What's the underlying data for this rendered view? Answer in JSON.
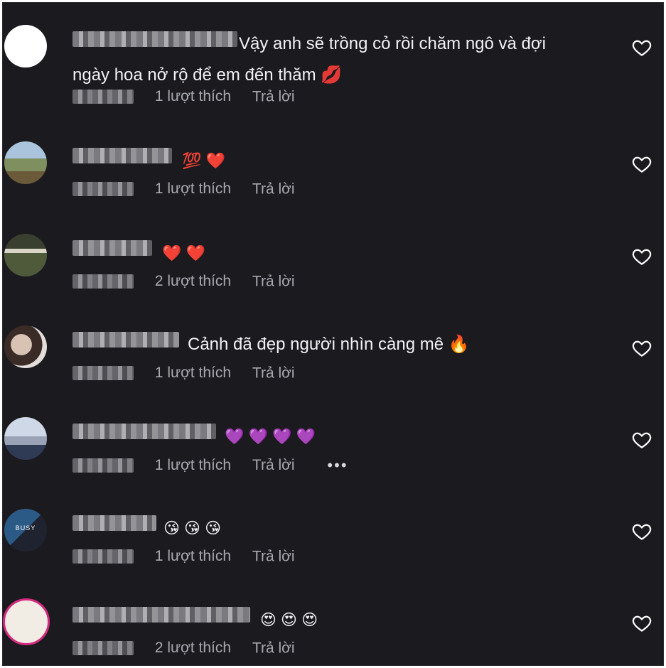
{
  "comments": [
    {
      "text1": "Vậy anh sẽ trồng cỏ rồi chăm ngô và đợi",
      "text2": "ngày hoa nở rộ để em đến thăm 💋",
      "likes": "1 lượt thích",
      "reply": "Trả lời"
    },
    {
      "text1": "💯 ❤️",
      "likes": "1 lượt thích",
      "reply": "Trả lời"
    },
    {
      "text1": "❤️ ❤️",
      "likes": "2 lượt thích",
      "reply": "Trả lời"
    },
    {
      "text1": "Cảnh đã đẹp người nhìn càng mê 🔥",
      "likes": "1 lượt thích",
      "reply": "Trả lời"
    },
    {
      "text1": "💜 💜 💜 💜",
      "likes": "1 lượt thích",
      "reply": "Trả lời",
      "more": "•••"
    },
    {
      "text1": "😘 😘 😘",
      "likes": "1 lượt thích",
      "reply": "Trả lời",
      "avatar_text": "BUSY"
    },
    {
      "text1": "😍 😍 😍",
      "likes": "2 lượt thích",
      "reply": "Trả lời"
    }
  ]
}
